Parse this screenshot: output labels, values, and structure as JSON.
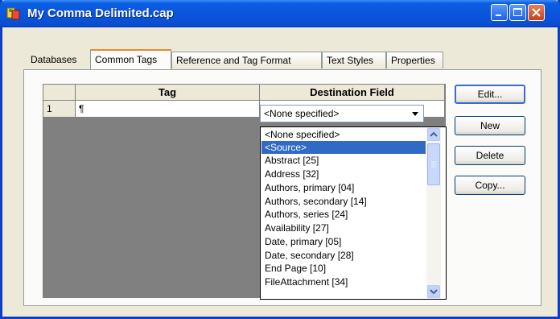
{
  "window": {
    "title": "My Comma Delimited.cap"
  },
  "tabs": [
    {
      "label": "Databases"
    },
    {
      "label": "Common Tags"
    },
    {
      "label": "Reference and Tag Format"
    },
    {
      "label": "Text Styles"
    },
    {
      "label": "Properties"
    }
  ],
  "selected_tab": "Common Tags",
  "grid": {
    "headers": [
      "",
      "Tag",
      "Destination Field"
    ],
    "rows": [
      {
        "num": "1",
        "tag": "¶",
        "destination": "<None specified>"
      }
    ]
  },
  "dropdown": {
    "selected": "<Source>",
    "options": [
      "<None specified>",
      "<Source>",
      "Abstract [25]",
      "Address [32]",
      "Authors, primary [04]",
      "Authors, secondary [14]",
      "Authors, series [24]",
      "Availability [27]",
      "Date, primary [05]",
      "Date, secondary [28]",
      "End Page [10]",
      "FileAttachment [34]"
    ]
  },
  "buttons": {
    "edit": "Edit...",
    "new": "New",
    "delete": "Delete",
    "copy": "Copy..."
  },
  "colors": {
    "titlebar": "#0a55dc",
    "selection": "#316ac5",
    "tab_highlight": "#e68b2c"
  }
}
